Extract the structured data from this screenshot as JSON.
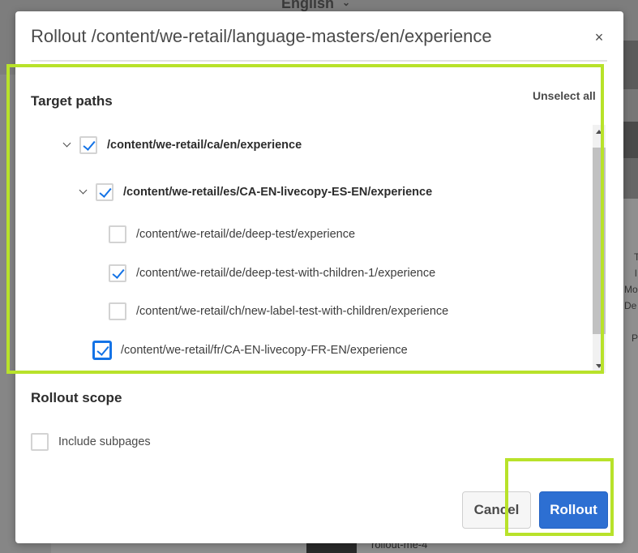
{
  "background": {
    "language": "English",
    "side_texts": [
      "T",
      "l",
      "Mo",
      "De",
      "P"
    ],
    "footer_item": "rollout-me-4"
  },
  "dialog": {
    "title": "Rollout /content/we-retail/language-masters/en/experience",
    "close_label": "×",
    "target_paths": {
      "label": "Target paths",
      "unselect_all": "Unselect all",
      "items": [
        {
          "path": "/content/we-retail/ca/en/experience",
          "checked": true,
          "bold": true,
          "expandable": true
        },
        {
          "path": "/content/we-retail/es/CA-EN-livecopy-ES-EN/experience",
          "checked": true,
          "bold": true,
          "expandable": true
        },
        {
          "path": "/content/we-retail/de/deep-test/experience",
          "checked": false,
          "bold": false,
          "expandable": false
        },
        {
          "path": "/content/we-retail/de/deep-test-with-children-1/experience",
          "checked": true,
          "bold": false,
          "expandable": false
        },
        {
          "path": "/content/we-retail/ch/new-label-test-with-children/experience",
          "checked": false,
          "bold": false,
          "expandable": false
        },
        {
          "path": "/content/we-retail/fr/CA-EN-livecopy-FR-EN/experience",
          "checked": true,
          "bold": false,
          "expandable": false
        }
      ]
    },
    "rollout_scope": {
      "label": "Rollout scope",
      "include_subpages_label": "Include subpages",
      "include_subpages_checked": false
    },
    "buttons": {
      "cancel": "Cancel",
      "rollout": "Rollout"
    },
    "colors": {
      "accent": "#1473e6",
      "primary_button": "#2d6fd2",
      "highlight": "#b8e22a"
    }
  }
}
